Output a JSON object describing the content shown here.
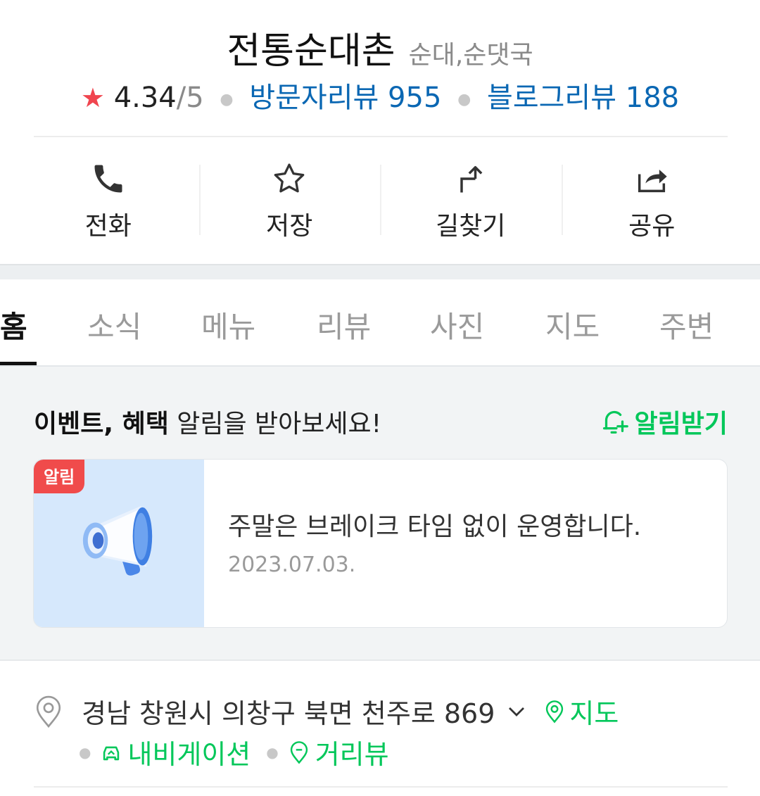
{
  "place": {
    "name": "전통순대촌",
    "category": "순대,순댓국"
  },
  "rating": {
    "star_icon": "star-icon",
    "score": "4.34",
    "out_of": "/5",
    "visitor_reviews": "방문자리뷰 955",
    "blog_reviews": "블로그리뷰 188"
  },
  "actions": [
    {
      "label": "전화",
      "icon": "phone-icon"
    },
    {
      "label": "저장",
      "icon": "star-outline-icon"
    },
    {
      "label": "길찾기",
      "icon": "directions-icon"
    },
    {
      "label": "공유",
      "icon": "share-icon"
    }
  ],
  "tabs": [
    {
      "label": "홈",
      "active": true
    },
    {
      "label": "소식",
      "active": false
    },
    {
      "label": "메뉴",
      "active": false
    },
    {
      "label": "리뷰",
      "active": false
    },
    {
      "label": "사진",
      "active": false
    },
    {
      "label": "지도",
      "active": false
    },
    {
      "label": "주변",
      "active": false
    }
  ],
  "event": {
    "headline_bold": "이벤트, 혜택",
    "headline_rest": " 알림을 받아보세요!",
    "subscribe_label": "알림받기",
    "badge": "알림",
    "notice_text": "주말은 브레이크 타임 없이 운영합니다.",
    "notice_date": "2023.07.03."
  },
  "address": {
    "text": "경남 창원시 의창구 북면 천주로 869",
    "map_label": "지도",
    "navigation_label": "내비게이션",
    "street_view_label": "거리뷰"
  },
  "colors": {
    "accent_green": "#03c75a",
    "link_blue": "#0a67b3",
    "star_red": "#f0454f",
    "badge_red": "#f04b4b"
  }
}
